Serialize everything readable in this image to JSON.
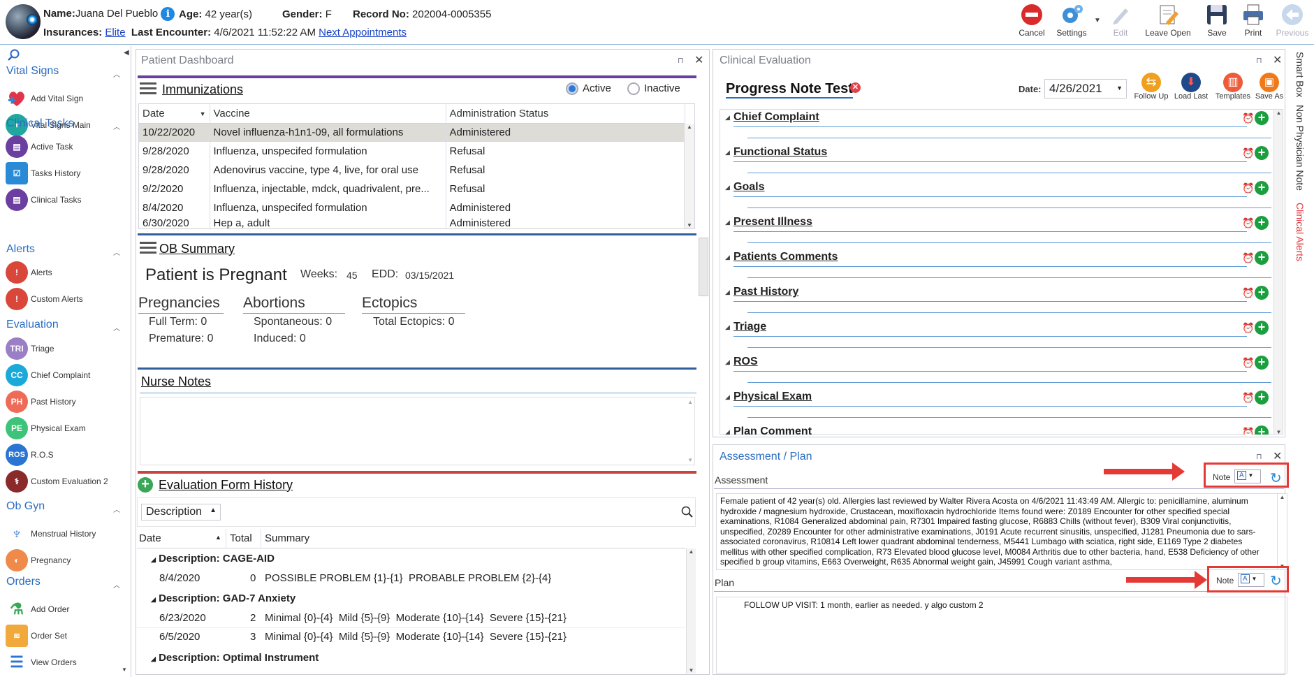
{
  "header": {
    "name_label": "Name:",
    "name": "Juana Del Pueblo",
    "age_label": "Age:",
    "age": "42 year(s)",
    "gender_label": "Gender:",
    "gender": "F",
    "record_label": "Record No:",
    "record": "202004-0005355",
    "insurances_label": "Insurances:",
    "insurance": "Elite",
    "last_encounter_label": "Last Encounter:",
    "last_encounter": "4/6/2021 11:52:22 AM",
    "next_appointments": "Next Appointments",
    "info_glyph": "i"
  },
  "toolbar": {
    "cancel": "Cancel",
    "settings": "Settings",
    "edit": "Edit",
    "leave_open": "Leave Open",
    "save": "Save",
    "print": "Print",
    "previous": "Previous"
  },
  "sidebar": {
    "sections": {
      "vital": "Vital Signs",
      "clinical": "Clinical Tasks",
      "alerts": "Alerts",
      "evaluation": "Evaluation",
      "obgyn": "Ob Gyn",
      "orders": "Orders"
    },
    "items": {
      "add_vital": "Add Vital Sign",
      "vital_main": "Vital Signs Main",
      "active_task": "Active Task",
      "tasks_history": "Tasks History",
      "clinical_tasks": "Clinical Tasks",
      "alerts": "Alerts",
      "custom_alerts": "Custom Alerts",
      "triage": "Triage",
      "chief_complaint": "Chief Complaint",
      "past_history": "Past History",
      "physical_exam": "Physical Exam",
      "ros": "R.O.S",
      "custom_eval": "Custom Evaluation 2",
      "menstrual": "Menstrual History",
      "pregnancy": "Pregnancy",
      "add_order": "Add Order",
      "order_set": "Order Set",
      "view_orders": "View Orders"
    },
    "icon_text": {
      "triage": "TRI",
      "chief_complaint": "CC",
      "past_history": "PH",
      "physical_exam": "PE",
      "ros": "ROS"
    }
  },
  "dashboard": {
    "title": "Patient Dashboard",
    "immunizations": {
      "title": "Immunizations",
      "active": "Active",
      "inactive": "Inactive",
      "columns": [
        "Date",
        "Vaccine",
        "Administration Status"
      ],
      "rows": [
        [
          "10/22/2020",
          "Novel influenza-h1n1-09, all formulations",
          "Administered"
        ],
        [
          "9/28/2020",
          "Influenza, unspecifed formulation",
          "Refusal"
        ],
        [
          "9/28/2020",
          "Adenovirus vaccine, type 4, live, for oral use",
          "Refusal"
        ],
        [
          "9/2/2020",
          "Influenza, injectable, mdck, quadrivalent, pre...",
          "Refusal"
        ],
        [
          "8/4/2020",
          "Influenza, unspecifed formulation",
          "Administered"
        ],
        [
          "6/30/2020",
          "Hep a, adult",
          "Administered"
        ]
      ]
    },
    "ob": {
      "title": "OB Summary",
      "status": "Patient is Pregnant",
      "weeks_label": "Weeks:",
      "weeks": "45",
      "edd_label": "EDD:",
      "edd": "03/15/2021",
      "pregnancies": "Pregnancies",
      "full_term": "Full Term: 0",
      "premature": "Premature: 0",
      "abortions": "Abortions",
      "spontaneous": "Spontaneous: 0",
      "induced": "Induced: 0",
      "ectopics": "Ectopics",
      "total_ectopics": "Total Ectopics: 0"
    },
    "nurse_notes": "Nurse Notes",
    "eval_history": {
      "title": "Evaluation Form History",
      "group_by": "Description",
      "columns": [
        "Date",
        "Total",
        "Summary"
      ],
      "groups": [
        {
          "label": "Description: CAGE-AID",
          "rows": [
            [
              "8/4/2020",
              "0",
              "POSSIBLE PROBLEM {1}-{1}  PROBABLE PROBLEM {2}-{4}"
            ]
          ]
        },
        {
          "label": "Description: GAD-7 Anxiety",
          "rows": [
            [
              "6/23/2020",
              "2",
              "Minimal {0}-{4}  Mild {5}-{9}  Moderate {10}-{14}  Severe {15}-{21}"
            ],
            [
              "6/5/2020",
              "3",
              "Minimal {0}-{4}  Mild {5}-{9}  Moderate {10}-{14}  Severe {15}-{21}"
            ]
          ]
        },
        {
          "label": "Description: Optimal Instrument",
          "rows": []
        }
      ]
    }
  },
  "clinical": {
    "title": "Clinical Evaluation",
    "note_title": "Progress Note Test",
    "date_label": "Date:",
    "date": "4/26/2021",
    "follow_up": "Follow Up",
    "load_last": "Load Last",
    "templates": "Templates",
    "save_as": "Save As",
    "sections": [
      "Chief Complaint",
      "Functional Status",
      "Goals",
      "Present Illness",
      "Patients Comments",
      "Past History",
      "Triage",
      "ROS",
      "Physical Exam",
      "Plan Comment"
    ]
  },
  "assessment": {
    "title": "Assessment / Plan",
    "assessment_label": "Assessment",
    "note_label": "Note",
    "text": "Female patient of 42 year(s) old. Allergies last reviewed by Walter Rivera Acosta on 4/6/2021 11:43:49 AM. Allergic to:  penicillamine, aluminum hydroxide / magnesium hydroxide, Crustacean, moxifloxacin hydrochloride          Items found were:  Z0189 Encounter for other specified special examinations, R1084 Generalized abdominal pain, R7301 Impaired fasting glucose, R6883 Chills (without fever), B309 Viral conjunctivitis, unspecified, Z0289 Encounter for other administrative examinations, J0191 Acute recurrent sinusitis, unspecified, J1281 Pneumonia due to sars-associated coronavirus, R10814 Left lower quadrant abdominal tenderness, M5441 Lumbago with sciatica, right side, E1169 Type 2 diabetes mellitus with other specified complication, R73 Elevated blood glucose level, M0084 Arthritis due to other bacteria, hand, E538 Deficiency of other specified b group vitamins, E663 Overweight, R635 Abnormal weight gain, J45991 Cough variant asthma, ",
    "plan_label": "Plan",
    "plan_text": "FOLLOW UP VISIT: 1 month, earlier as needed. y algo custom 2"
  },
  "right_tabs": {
    "smart_box": "Smart Box",
    "non_physician": "Non Physician Note",
    "clinical_alerts": "Clinical Alerts"
  }
}
